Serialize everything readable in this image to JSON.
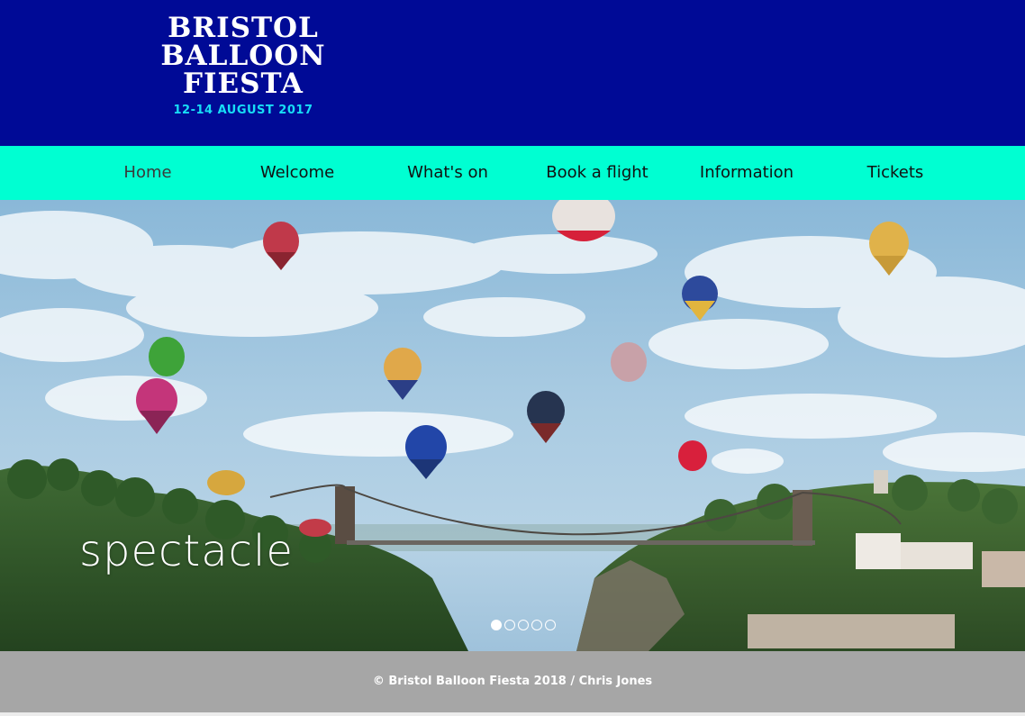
{
  "header": {
    "logo": {
      "lines": [
        "BRISTOL",
        "BALLOON",
        "FIESTA"
      ],
      "dates": "12-14 AUGUST 2017"
    }
  },
  "nav": {
    "items": [
      {
        "label": "Home",
        "active": true
      },
      {
        "label": "Welcome",
        "active": false
      },
      {
        "label": "What's on",
        "active": false
      },
      {
        "label": "Book a flight",
        "active": false
      },
      {
        "label": "Information",
        "active": false
      },
      {
        "label": "Tickets",
        "active": false
      }
    ]
  },
  "hero": {
    "caption": "spectacle",
    "slides_count": 5,
    "active_slide": 1
  },
  "footer": {
    "text": "© Bristol Balloon Fiesta 2018 / Chris Jones"
  },
  "colors": {
    "header_bg": "#000a96",
    "nav_bg": "#00ffd2",
    "date_accent": "#17ddf6",
    "footer_bg": "#a6a6a6"
  }
}
